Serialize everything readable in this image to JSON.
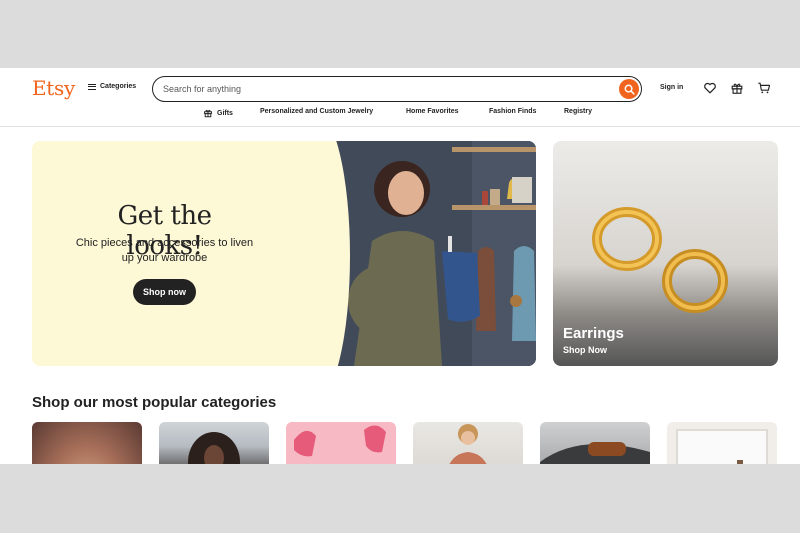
{
  "header": {
    "logo": "Etsy",
    "categories_label": "Categories",
    "search_placeholder": "Search for anything",
    "signin_label": "Sign in",
    "icons": [
      "search-icon",
      "heart-icon",
      "gift-icon",
      "cart-icon"
    ]
  },
  "subnav": {
    "items": [
      "Gifts",
      "Personalized and Custom Jewelry",
      "Home Favorites",
      "Fashion Finds",
      "Registry"
    ]
  },
  "hero": {
    "title": "Get the looks!",
    "subtitle": "Chic pieces and accessories to liven up your wardrobe",
    "button": "Shop now"
  },
  "earrings_card": {
    "title": "Earrings",
    "subtitle": "Shop Now"
  },
  "popular": {
    "title": "Shop our most popular categories"
  },
  "colors": {
    "brand": "#f1641e",
    "hero_bg": "#fdf8d6",
    "text": "#222222"
  }
}
